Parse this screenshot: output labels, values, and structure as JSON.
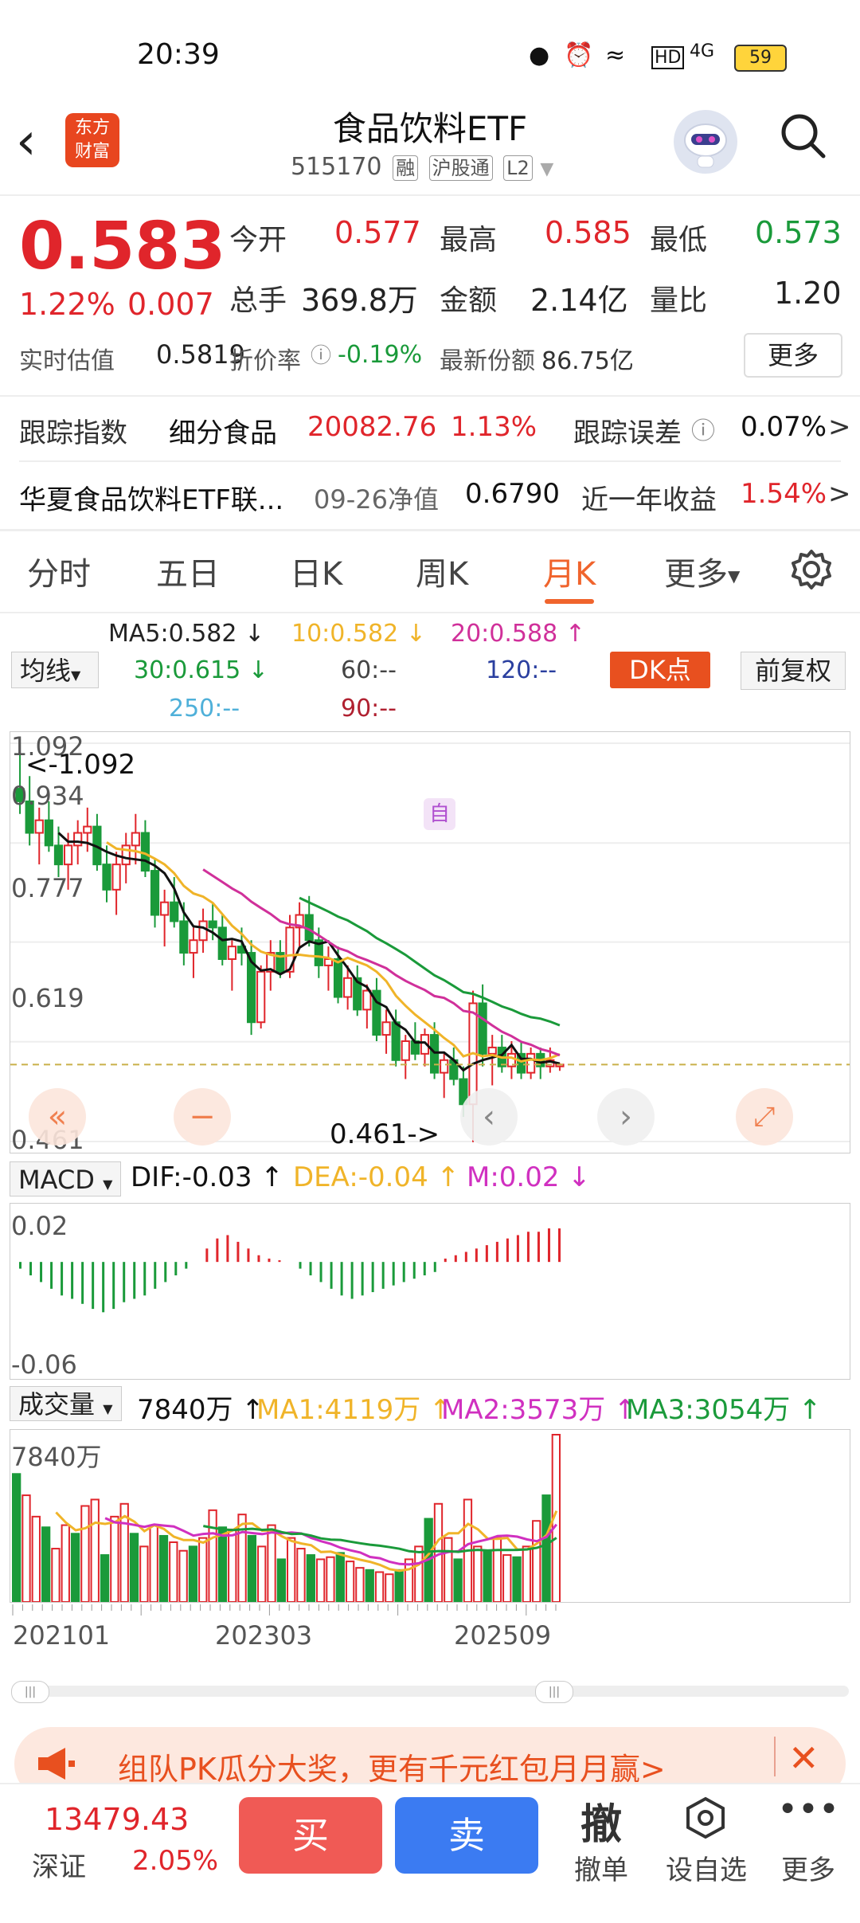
{
  "status": {
    "time": "20:39",
    "battery": "59",
    "signal": "4G"
  },
  "header": {
    "back_icon": "chevron-left-icon",
    "logo_text": "东方\n财富",
    "title": "食品饮料ETF",
    "code": "515170",
    "tags": [
      "融",
      "沪股通",
      "L2"
    ]
  },
  "quote": {
    "price": "0.583",
    "pct": "1.22%",
    "change": "0.007",
    "open_label": "今开",
    "open": "0.577",
    "high_label": "最高",
    "high": "0.585",
    "low_label": "最低",
    "low": "0.573",
    "volume_label": "总手",
    "volume": "369.8万",
    "amount_label": "金额",
    "amount": "2.14亿",
    "ratio_label": "量比",
    "ratio": "1.20",
    "est_label": "实时估值",
    "est": "0.5819",
    "premium_label": "折价率",
    "premium": "-0.19%",
    "shares_label": "最新份额",
    "shares": "86.75亿",
    "more": "更多"
  },
  "tracking": {
    "label": "跟踪指数",
    "index_name": "细分食品",
    "index_value": "20082.76",
    "index_pct": "1.13%",
    "error_label": "跟踪误差",
    "error_value": "0.07%"
  },
  "fund": {
    "name": "华夏食品饮料ETF联...",
    "nav_label": "09-26净值",
    "nav": "0.6790",
    "return_label": "近一年收益",
    "return": "1.54%"
  },
  "tabs": [
    "分时",
    "五日",
    "日K",
    "周K",
    "月K",
    "更多"
  ],
  "ma": {
    "ma5": "MA5:0.582",
    "ma10": "10:0.582",
    "ma20": "20:0.588",
    "ma30": "30:0.615",
    "ma60": "60:--",
    "ma120": "120:--",
    "ma250": "250:--",
    "ma90": "90:--",
    "junxian": "均线",
    "dk": "DK点",
    "fq": "前复权"
  },
  "kline": {
    "y_labels": [
      "1.092",
      "0.934",
      "0.777",
      "0.619",
      "0.461"
    ],
    "max_label": "<-1.092",
    "min_label": "0.461->",
    "marker_zi": "自"
  },
  "macd": {
    "selector": "MACD",
    "dif": "DIF:-0.03",
    "dea": "DEA:-0.04",
    "m": "M:0.02",
    "y_top": "0.02",
    "y_bottom": "-0.06"
  },
  "vol": {
    "selector": "成交量",
    "value": "7840万",
    "ma1": "MA1:4119万",
    "ma2": "MA2:3573万",
    "ma3": "MA3:3054万",
    "y_top": "7840万",
    "x_labels": [
      "202101",
      "202303",
      "202509"
    ]
  },
  "banner": {
    "text": "组队PK瓜分大奖，更有千元红包月月赢>"
  },
  "bottom": {
    "index_value": "13479.43",
    "index_name": "深证",
    "index_pct": "2.05%",
    "buy": "买",
    "sell": "卖",
    "cancel_icon": "撤",
    "cancel": "撤单",
    "watch": "设自选",
    "more": "更多"
  },
  "colors": {
    "up": "#e0252b",
    "down": "#1a9a3a",
    "accent": "#f0642d"
  },
  "chart_data": [
    {
      "type": "candlestick",
      "title": "",
      "xlabel": "",
      "ylabel": "",
      "ylim": [
        0.461,
        1.092
      ],
      "x_ticks": [
        "202101",
        "202303",
        "202509"
      ],
      "ohlc": [
        [
          1.02,
          1.09,
          0.98,
          1.0
        ],
        [
          1.0,
          1.04,
          0.93,
          0.95
        ],
        [
          0.95,
          0.99,
          0.9,
          0.97
        ],
        [
          0.97,
          1.0,
          0.92,
          0.93
        ],
        [
          0.93,
          0.96,
          0.88,
          0.9
        ],
        [
          0.9,
          0.95,
          0.86,
          0.93
        ],
        [
          0.93,
          0.97,
          0.9,
          0.95
        ],
        [
          0.95,
          0.99,
          0.92,
          0.96
        ],
        [
          0.96,
          0.98,
          0.89,
          0.9
        ],
        [
          0.9,
          0.93,
          0.84,
          0.86
        ],
        [
          0.86,
          0.92,
          0.82,
          0.9
        ],
        [
          0.9,
          0.95,
          0.87,
          0.93
        ],
        [
          0.93,
          0.98,
          0.9,
          0.95
        ],
        [
          0.95,
          0.97,
          0.88,
          0.89
        ],
        [
          0.89,
          0.91,
          0.8,
          0.82
        ],
        [
          0.82,
          0.86,
          0.77,
          0.84
        ],
        [
          0.84,
          0.88,
          0.8,
          0.81
        ],
        [
          0.81,
          0.84,
          0.74,
          0.76
        ],
        [
          0.76,
          0.8,
          0.72,
          0.78
        ],
        [
          0.78,
          0.83,
          0.76,
          0.81
        ],
        [
          0.81,
          0.84,
          0.78,
          0.8
        ],
        [
          0.8,
          0.82,
          0.74,
          0.75
        ],
        [
          0.75,
          0.78,
          0.7,
          0.77
        ],
        [
          0.77,
          0.8,
          0.74,
          0.76
        ],
        [
          0.76,
          0.78,
          0.63,
          0.65
        ],
        [
          0.65,
          0.74,
          0.64,
          0.73
        ],
        [
          0.73,
          0.78,
          0.7,
          0.76
        ],
        [
          0.76,
          0.78,
          0.72,
          0.73
        ],
        [
          0.73,
          0.82,
          0.72,
          0.8
        ],
        [
          0.8,
          0.84,
          0.77,
          0.82
        ],
        [
          0.82,
          0.85,
          0.77,
          0.78
        ],
        [
          0.78,
          0.8,
          0.72,
          0.74
        ],
        [
          0.74,
          0.77,
          0.7,
          0.75
        ],
        [
          0.75,
          0.77,
          0.68,
          0.69
        ],
        [
          0.69,
          0.74,
          0.67,
          0.72
        ],
        [
          0.72,
          0.74,
          0.66,
          0.67
        ],
        [
          0.67,
          0.71,
          0.64,
          0.7
        ],
        [
          0.7,
          0.72,
          0.62,
          0.63
        ],
        [
          0.63,
          0.67,
          0.6,
          0.65
        ],
        [
          0.65,
          0.67,
          0.58,
          0.59
        ],
        [
          0.59,
          0.63,
          0.56,
          0.62
        ],
        [
          0.62,
          0.65,
          0.59,
          0.6
        ],
        [
          0.6,
          0.64,
          0.58,
          0.63
        ],
        [
          0.63,
          0.65,
          0.56,
          0.57
        ],
        [
          0.57,
          0.6,
          0.53,
          0.59
        ],
        [
          0.59,
          0.61,
          0.55,
          0.56
        ],
        [
          0.56,
          0.58,
          0.5,
          0.52
        ],
        [
          0.52,
          0.7,
          0.46,
          0.68
        ],
        [
          0.68,
          0.71,
          0.58,
          0.6
        ],
        [
          0.6,
          0.63,
          0.55,
          0.61
        ],
        [
          0.61,
          0.63,
          0.57,
          0.58
        ],
        [
          0.58,
          0.62,
          0.56,
          0.6
        ],
        [
          0.6,
          0.62,
          0.56,
          0.57
        ],
        [
          0.57,
          0.61,
          0.56,
          0.6
        ],
        [
          0.6,
          0.61,
          0.56,
          0.58
        ],
        [
          0.58,
          0.61,
          0.57,
          0.59
        ],
        [
          0.58,
          0.585,
          0.573,
          0.583
        ]
      ]
    },
    {
      "type": "bar",
      "title": "",
      "xlabel": "",
      "ylabel": "",
      "series": [
        {
          "name": "M",
          "values": [
            -0.004,
            -0.008,
            -0.012,
            -0.016,
            -0.02,
            -0.022,
            -0.025,
            -0.028,
            -0.03,
            -0.028,
            -0.024,
            -0.022,
            -0.02,
            -0.016,
            -0.012,
            -0.008,
            -0.004,
            0.0,
            0.008,
            0.014,
            0.016,
            0.012,
            0.008,
            0.004,
            0.002,
            0.001,
            0.0,
            -0.004,
            -0.008,
            -0.012,
            -0.016,
            -0.02,
            -0.022,
            -0.02,
            -0.018,
            -0.016,
            -0.014,
            -0.012,
            -0.01,
            -0.008,
            -0.006,
            0.002,
            0.004,
            0.006,
            0.008,
            0.01,
            0.012,
            0.014,
            0.016,
            0.018,
            0.018,
            0.02,
            0.02
          ]
        }
      ],
      "ylim": [
        -0.06,
        0.02
      ]
    },
    {
      "type": "bar",
      "title": "",
      "xlabel": "",
      "ylabel": "",
      "series": [
        {
          "name": "成交量",
          "values": [
            6.0,
            5.0,
            4.0,
            3.5,
            2.5,
            3.6,
            3.2,
            4.5,
            4.8,
            2.2,
            4.0,
            4.6,
            3.2,
            2.6,
            3.6,
            3.1,
            2.8,
            2.4,
            2.6,
            3.0,
            4.3,
            3.5,
            3.4,
            4.1,
            3.1,
            2.6,
            3.6,
            2.0,
            3.0,
            2.5,
            2.2,
            2.0,
            2.1,
            2.3,
            1.9,
            1.6,
            1.5,
            1.4,
            1.3,
            1.5,
            2.0,
            2.6,
            3.9,
            4.6,
            3.0,
            2.0,
            4.8,
            2.6,
            2.4,
            3.0,
            2.2,
            2.1,
            2.6,
            3.8,
            5.0,
            7.84
          ]
        }
      ],
      "ylim": [
        0,
        7.84
      ]
    }
  ]
}
